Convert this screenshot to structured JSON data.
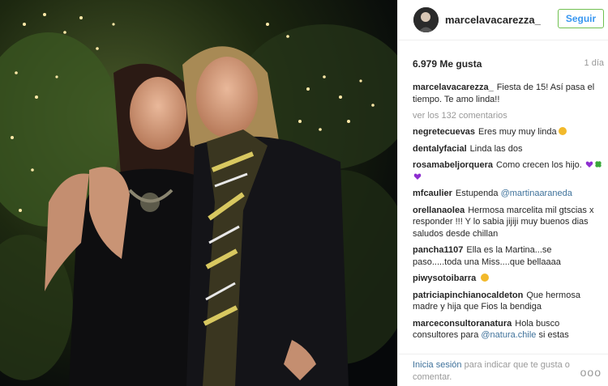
{
  "post": {
    "username": "marcelavacarezza_",
    "follow_label": "Seguir",
    "likes": "6.979 Me gusta",
    "age": "1 día",
    "caption": "Fiesta de 15! Así pasa el tiempo. Te amo linda!!",
    "view_all": "ver los 132 comentarios"
  },
  "comments": [
    {
      "user": "negretecuevas",
      "text": "Eres muy muy linda",
      "emoji": "surprised-emoji"
    },
    {
      "user": "dentalyfacial",
      "text": "Linda las dos"
    },
    {
      "user": "rosamabeljorquera",
      "text": "Como crecen los hijo.",
      "emoji": "purple-hearts-clover"
    },
    {
      "user": "mfcaulier",
      "text": "Estupenda",
      "mention": "@martinaaraneda"
    },
    {
      "user": "orellanaolea",
      "text": "Hermosa marcelita mil gtscias x responder !!! Y lo sabia jijiji muy buenos dias saludos desde chillan"
    },
    {
      "user": "pancha1107",
      "text": "Ella es la Martina...se paso.....toda una Miss....que bellaaaa"
    },
    {
      "user": "piwysotoibarra",
      "text": "",
      "emoji": "grimace-emoji"
    },
    {
      "user": "patriciapinchianocaldeton",
      "text": "Que hermosa madre y hija que Fios la bendiga"
    },
    {
      "user": "marceconsultoranatura",
      "text": "Hola busco consultores para",
      "mention": "@natura.chile",
      "text_after": "si estas"
    }
  ],
  "login": {
    "link": "Inicia sesión",
    "text": "para indicar que te gusta o comentar."
  },
  "more_label": "ooo",
  "colors": {
    "link": "#3f729b",
    "follow": "#3897f0",
    "muted": "#999999"
  }
}
